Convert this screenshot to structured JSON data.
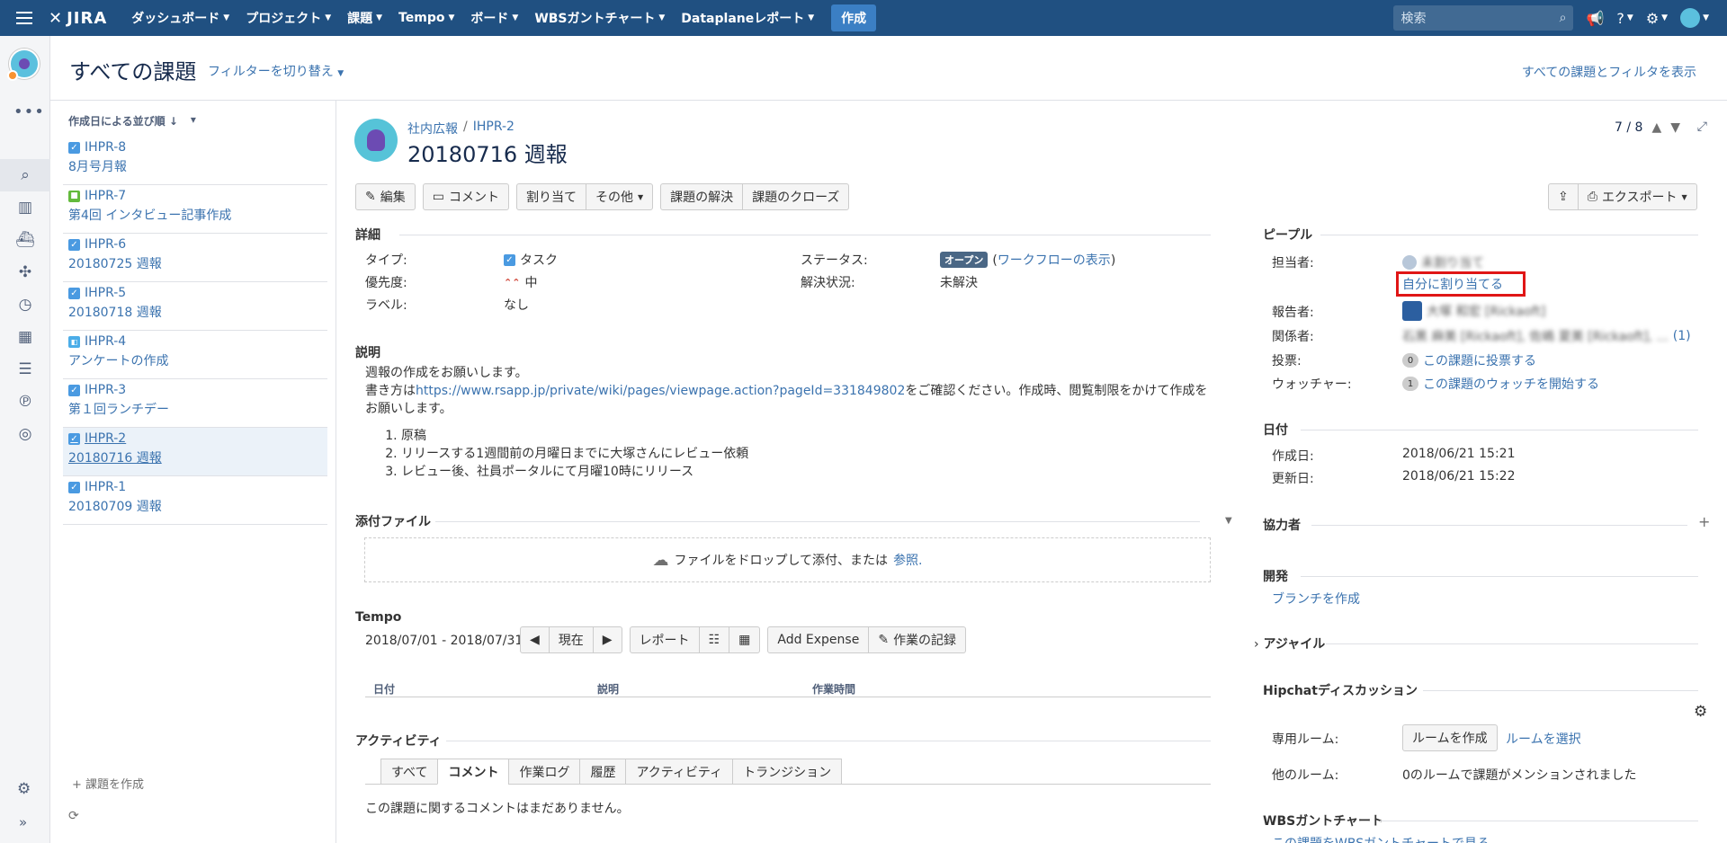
{
  "topbar": {
    "logo": "JIRA",
    "nav": [
      {
        "label": "ダッシュボード"
      },
      {
        "label": "プロジェクト"
      },
      {
        "label": "課題"
      },
      {
        "label": "Tempo"
      },
      {
        "label": "ボード"
      },
      {
        "label": "WBSガントチャート"
      },
      {
        "label": "Dataplaneレポート"
      }
    ],
    "create_label": "作成",
    "search_placeholder": "検索"
  },
  "page": {
    "title": "すべての課題",
    "switch_filter": "フィルターを切り替え",
    "show_all": "すべての課題とフィルタを表示"
  },
  "list": {
    "sort_label": "作成日による並び順",
    "items": [
      {
        "key": "IHPR-8",
        "summary": "8月号月報",
        "type": "task"
      },
      {
        "key": "IHPR-7",
        "summary": "第4回 インタビュー記事作成",
        "type": "story"
      },
      {
        "key": "IHPR-6",
        "summary": "20180725 週報",
        "type": "task"
      },
      {
        "key": "IHPR-5",
        "summary": "20180718 週報",
        "type": "task"
      },
      {
        "key": "IHPR-4",
        "summary": "アンケートの作成",
        "type": "subtask"
      },
      {
        "key": "IHPR-3",
        "summary": "第１回ランチデー",
        "type": "task"
      },
      {
        "key": "IHPR-2",
        "summary": "20180716 週報",
        "type": "task"
      },
      {
        "key": "IHPR-1",
        "summary": "20180709 週報",
        "type": "task"
      }
    ],
    "create_issue": "+ 課題を作成"
  },
  "issue": {
    "project": "社内広報",
    "key": "IHPR-2",
    "title": "20180716 週報",
    "pager": "7 / 8",
    "toolbar": {
      "edit": "編集",
      "comment": "コメント",
      "assign": "割り当て",
      "more": "その他",
      "resolve": "課題の解決",
      "close": "課題のクローズ",
      "export": "エクスポート"
    },
    "details": {
      "section": "詳細",
      "type_label": "タイプ:",
      "type_value": "タスク",
      "priority_label": "優先度:",
      "priority_value": "中",
      "labels_label": "ラベル:",
      "labels_value": "なし",
      "status_label": "ステータス:",
      "status_value": "オープン",
      "workflow_link": "ワークフローの表示",
      "resolution_label": "解決状況:",
      "resolution_value": "未解決"
    },
    "description": {
      "section": "説明",
      "line1": "週報の作成をお願いします。",
      "line2_prefix": "書き方は",
      "line2_link": "https://www.rsapp.jp/private/wiki/pages/viewpage.action?pageId=331849802",
      "line2_suffix": "をご確認ください。作成時、閲覧制限をかけて作成をお願いします。",
      "steps": [
        "原稿",
        "リリースする1週間前の月曜日までに大塚さんにレビュー依頼",
        "レビュー後、社員ポータルにて月曜10時にリリース"
      ]
    },
    "attachments": {
      "section": "添付ファイル",
      "drop_text": "ファイルをドロップして添付、または",
      "browse": "参照."
    },
    "tempo": {
      "section": "Tempo",
      "range": "2018/07/01 - 2018/07/31",
      "now": "現在",
      "report": "レポート",
      "add_expense": "Add Expense",
      "log_work": "作業の記録",
      "col_date": "日付",
      "col_desc": "説明",
      "col_time": "作業時間"
    },
    "activity": {
      "section": "アクティビティ",
      "tabs": [
        "すべて",
        "コメント",
        "作業ログ",
        "履歴",
        "アクティビティ",
        "トランジション"
      ],
      "empty": "この課題に関するコメントはまだありません。"
    }
  },
  "people": {
    "section": "ピープル",
    "assignee_label": "担当者:",
    "assignee_value": "未割り当て",
    "assign_self": "自分に割り当てる",
    "reporter_label": "報告者:",
    "reporter_value": "大塚 和宏 [Rickaoft]",
    "involved_label": "関係者:",
    "involved_value": "石黒 麻美 [Rickaoft], 佐嶋 夏美 [Rickaoft], ...",
    "involved_more": "(1)",
    "votes_label": "投票:",
    "votes_count": "0",
    "votes_link": "この課題に投票する",
    "watchers_label": "ウォッチャー:",
    "watchers_count": "1",
    "watchers_link": "この課題のウォッチを開始する"
  },
  "dates": {
    "section": "日付",
    "created_label": "作成日:",
    "created_value": "2018/06/21 15:21",
    "updated_label": "更新日:",
    "updated_value": "2018/06/21 15:22"
  },
  "collaborators": {
    "section": "協力者"
  },
  "development": {
    "section": "開発",
    "create_branch": "ブランチを作成"
  },
  "agile": {
    "section": "アジャイル"
  },
  "hipchat": {
    "section": "Hipchatディスカッション",
    "room_label": "専用ルーム:",
    "create_room": "ルームを作成",
    "select_room": "ルームを選択",
    "other_label": "他のルーム:",
    "other_value": "0のルームで課題がメンションされました"
  },
  "wbs": {
    "section": "WBSガントチャート",
    "link": "この課題をWBSガントチャートで見る"
  },
  "colors": {
    "topbar": "#205081",
    "link": "#3b73af",
    "highlight": "#e01616"
  }
}
